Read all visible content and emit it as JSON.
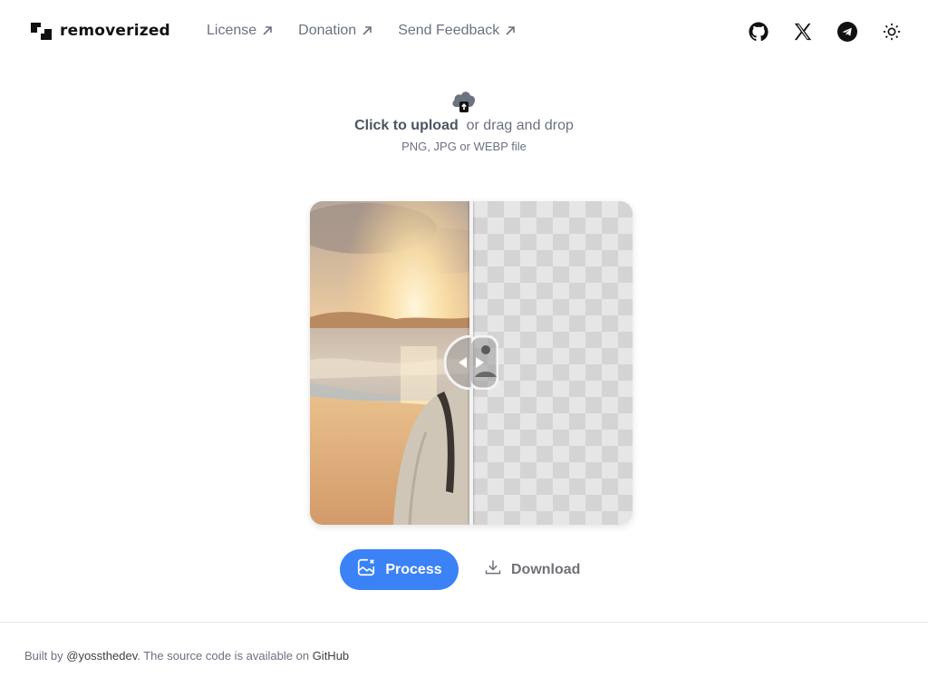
{
  "header": {
    "brand": "removerized",
    "nav": [
      {
        "label": "License",
        "icon": "arrow-up-right-icon"
      },
      {
        "label": "Donation",
        "icon": "arrow-up-right-icon"
      },
      {
        "label": "Send Feedback",
        "icon": "arrow-up-right-icon"
      }
    ],
    "socials": [
      "github-icon",
      "x-icon",
      "telegram-icon",
      "sun-icon"
    ]
  },
  "upload": {
    "strong": "Click to upload",
    "rest": "or drag and drop",
    "hint": "PNG, JPG or WEBP file",
    "icon": "cloud-upload-icon"
  },
  "viewer": {
    "split_percent": 50,
    "handle_icon": "compare-handle-icon"
  },
  "actions": {
    "process_label": "Process",
    "process_icon": "image-remove-icon",
    "download_label": "Download",
    "download_icon": "download-icon"
  },
  "footer": {
    "prefix": "Built by ",
    "author": "@yossthedev",
    "middle": ". The source code is available on ",
    "repo": "GitHub"
  },
  "colors": {
    "accent": "#3b82f6",
    "text": "#3f3f46",
    "muted": "#6b7280"
  }
}
